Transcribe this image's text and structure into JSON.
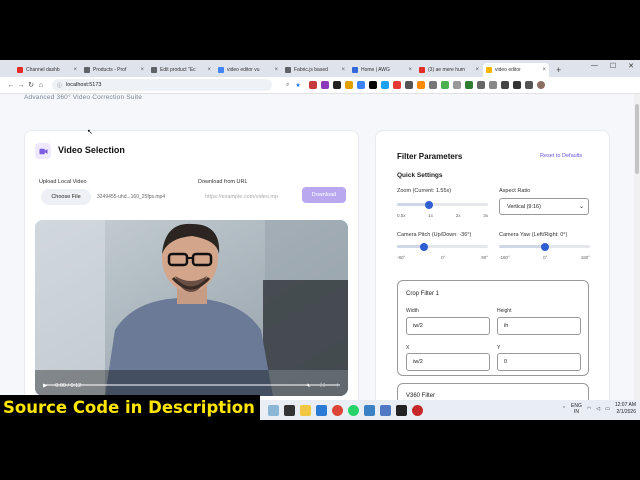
{
  "browser": {
    "tabs": [
      {
        "label": "Channel dashb",
        "color": "#e52d27"
      },
      {
        "label": "Products - Prof",
        "color": "#5f6368"
      },
      {
        "label": "Edit product \"Ec",
        "color": "#5f6368"
      },
      {
        "label": "video editor vu",
        "color": "#4285f4"
      },
      {
        "label": "Fabric.js based",
        "color": "#5f6368"
      },
      {
        "label": "Home | AWG",
        "color": "#3367d6"
      },
      {
        "label": "(3) ae mere hum",
        "color": "#e52d27"
      },
      {
        "label": "video editor",
        "color": "#f4b400"
      }
    ],
    "new_tab": "+",
    "url": "localhost:5173"
  },
  "page": {
    "subtitle": "Advanced 360° Video Correction Suite",
    "left": {
      "title": "Video Selection",
      "upload_label": "Upload Local Video",
      "choose_file": "Choose File",
      "file_name": "3249455-uhd...160_25fps.mp4",
      "download_label": "Download from URL",
      "url_placeholder": "https://example.com/video.mp",
      "download_button": "Download",
      "video_time": "0:00 / 0:12"
    },
    "right": {
      "title": "Filter Parameters",
      "reset": "Reset to Defaults",
      "quick_settings": "Quick Settings",
      "zoom_label": "Zoom (Current: 1.55x)",
      "zoom_value": 0.35,
      "zoom_ticks": [
        "0.5x",
        "1x",
        "2x",
        "3x"
      ],
      "aspect_label": "Aspect Ratio",
      "aspect_value": "Vertical (9:16)",
      "pitch_label": "Camera Pitch (Up/Down: -36°)",
      "pitch_value": 0.3,
      "pitch_ticks": [
        "-90°",
        "0°",
        "90°"
      ],
      "yaw_label": "Camera Yaw (Left/Right: 0°)",
      "yaw_value": 0.5,
      "yaw_ticks": [
        "-180°",
        "0°",
        "180°"
      ],
      "crop_title": "Crop Filter 1",
      "width_label": "Width",
      "width_value": "iw/2",
      "height_label": "Height",
      "height_value": "ih",
      "x_label": "X",
      "x_value": "iw/2",
      "y_label": "Y",
      "y_value": "0",
      "v360_title": "V360 Filter"
    }
  },
  "banner": "Source Code in  Description",
  "taskbar": {
    "lang_top": "ENG",
    "lang_bottom": "IN",
    "time": "12:07 AM",
    "date": "2/1/2026"
  }
}
